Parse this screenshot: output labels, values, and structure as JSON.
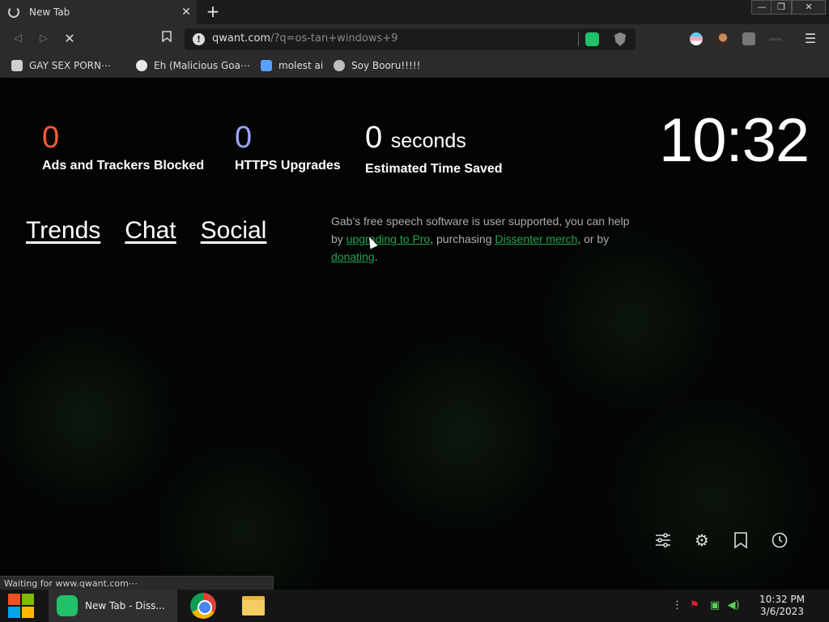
{
  "browser": {
    "tab": {
      "title": "New Tab",
      "close_label": "✕"
    },
    "new_tab_label": "+",
    "window_controls": {
      "minimize": "—",
      "restore": "❐",
      "close": "✕"
    },
    "url": {
      "host": "qwant.com",
      "path": "/?q=os-tan+windows+9"
    },
    "bookmarks": [
      {
        "label": "GAY SEX PORN⋯",
        "icon": "3d-cube-icon",
        "color": "#cfcfcf"
      },
      {
        "label": "Eh (Malicious Goa⋯",
        "icon": "globe-icon",
        "color": "#e8e8e8"
      },
      {
        "label": "molest ai",
        "icon": "puzzle-icon",
        "color": "#5aa0ff"
      },
      {
        "label": "Soy Booru!!!!!",
        "icon": "soyjak-icon",
        "color": "#bdbdbd"
      }
    ],
    "status_text": "Waiting for www.qwant.com⋯"
  },
  "newtab": {
    "stats": [
      {
        "value": "0",
        "unit": "",
        "label": "Ads and Trackers Blocked",
        "color": "#ff5a36"
      },
      {
        "value": "0",
        "unit": "",
        "label": "HTTPS Upgrades",
        "color": "#9ea5ff"
      },
      {
        "value": "0",
        "unit": "seconds",
        "label": "Estimated Time Saved",
        "color": "#ffffff"
      }
    ],
    "clock": "10:32",
    "links": [
      "Trends",
      "Chat",
      "Social"
    ],
    "support": {
      "text1": "Gab's free speech software is user supported, you can help by ",
      "link1": "upgrading to Pro",
      "text2": ", purchasing ",
      "link2": "Dissenter merch",
      "text3": ", or by ",
      "link3": "donating",
      "text4": "."
    },
    "bottom_icons": [
      "sliders-icon",
      "gear-icon",
      "bookmark-icon",
      "history-icon"
    ]
  },
  "taskbar": {
    "active_task": "New Tab - Diss...",
    "time": "10:32 PM",
    "date": "3/6/2023"
  }
}
